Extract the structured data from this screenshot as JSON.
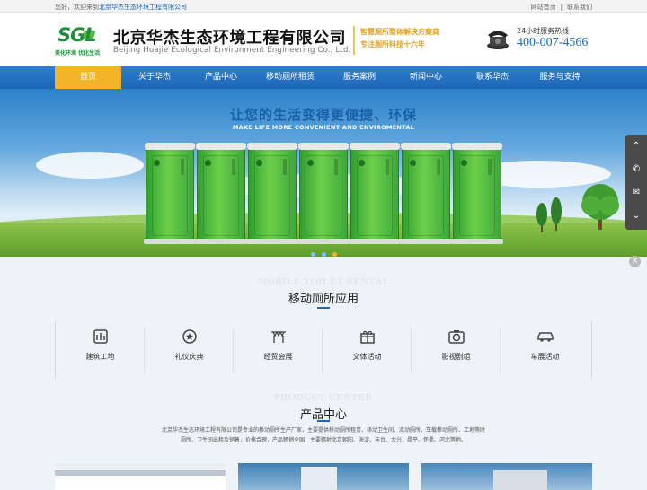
{
  "top_bar": {
    "welcome_prefix": "您好，欢迎来到",
    "welcome_brand": "北京华杰生态环境工程有限公司",
    "links": [
      "网站首页",
      "联系我们"
    ]
  },
  "header": {
    "logo_text": "SGL",
    "logo_slogan": "美化环境 优化生活",
    "company_cn": "北京华杰生态环境工程有限公司",
    "company_en": "Beijing Huajie Ecological Environment Engineering Co., Ltd.",
    "slogans": [
      "智慧厕所整体解决方案商",
      "专注厕所科技十六年"
    ],
    "hotline_label": "24小时服务热线",
    "hotline_number": "400-007-4566"
  },
  "nav": {
    "items": [
      "首页",
      "关于华杰",
      "产品中心",
      "移动厕所租赁",
      "服务案例",
      "新闻中心",
      "联系华杰",
      "服务与支持"
    ],
    "active_index": 0
  },
  "banner": {
    "title": "让您的生活变得更便捷、环保",
    "subtitle": "MAKE LIFE MORE CONVENIENT AND ENVIROMENTAL",
    "slide_count": 3,
    "active_slide": 3
  },
  "side_widget": {
    "icons": [
      "chevron-up-icon",
      "phone-icon",
      "wechat-icon",
      "chevron-down-icon"
    ]
  },
  "applications": {
    "ghost": "MOBILE TOILET RENTAL",
    "title": "移动厕所应用",
    "items": [
      {
        "label": "建筑工地",
        "icon": "construction-icon"
      },
      {
        "label": "礼仪庆典",
        "icon": "celebration-icon"
      },
      {
        "label": "经贸会展",
        "icon": "exhibition-icon"
      },
      {
        "label": "文体活动",
        "icon": "gift-icon"
      },
      {
        "label": "影视剧组",
        "icon": "camera-icon"
      },
      {
        "label": "车展活动",
        "icon": "car-icon"
      }
    ]
  },
  "products": {
    "ghost": "PRODUCT CENTER",
    "title": "产品中心",
    "description": "北京华杰生态环境工程有限公司是专业的移动厕所生产厂家，主要提供移动厕所租赁、移动卫生间、流动厕所、车载移动厕所、工地等时厕所、卫生间出租及销售，价格合理，产品畅销全国，主要辐射北京朝阳、海淀、丰台、大兴、昌平、怀柔、河北等地。"
  },
  "colors": {
    "brand_blue": "#1b6bc2",
    "nav_active": "#f2b52a",
    "brand_green": "#1f8f3a"
  }
}
